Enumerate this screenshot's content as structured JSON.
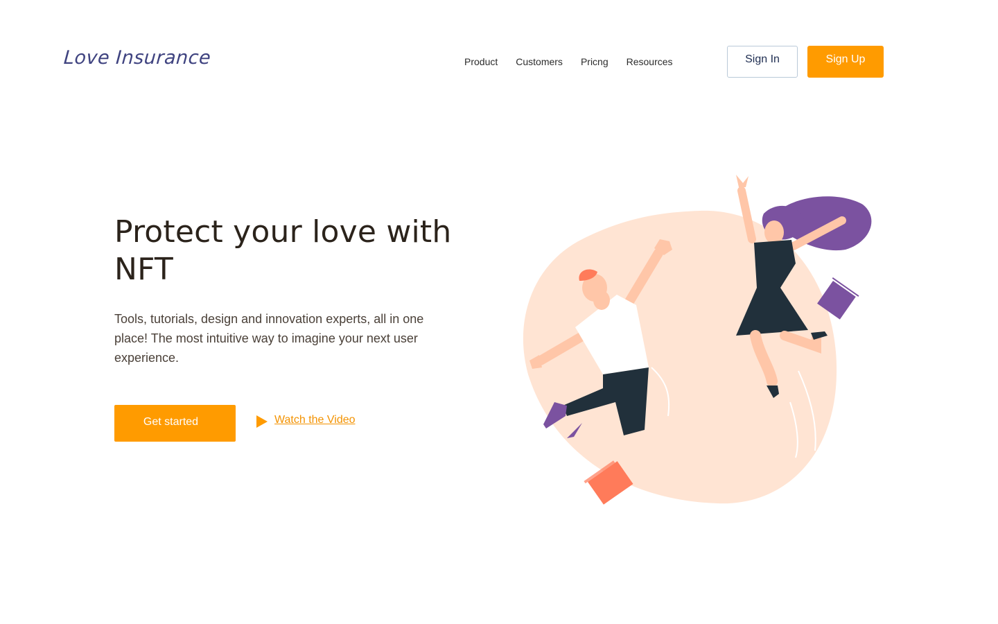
{
  "brand": {
    "logo_text": "Love Insurance"
  },
  "nav": {
    "items": [
      {
        "label": "Product"
      },
      {
        "label": "Customers"
      },
      {
        "label": "Pricng"
      },
      {
        "label": "Resources"
      }
    ]
  },
  "auth": {
    "sign_in_label": "Sign In",
    "sign_up_label": "Sign Up"
  },
  "hero": {
    "title": "Protect your love with NFT",
    "subtitle": "Tools, tutorials, design and innovation experts, all in one place! The most intuitive way to imagine your next user experience.",
    "cta_label": "Get started",
    "video_link_label": "Watch the Video"
  },
  "icons": {
    "play": "play-icon"
  },
  "colors": {
    "accent": "#ff9b00",
    "logo": "#3f4380",
    "blob": "#ffe4d3",
    "purple": "#7b52a0",
    "dark": "#21303b",
    "coral": "#ff7b5a"
  }
}
